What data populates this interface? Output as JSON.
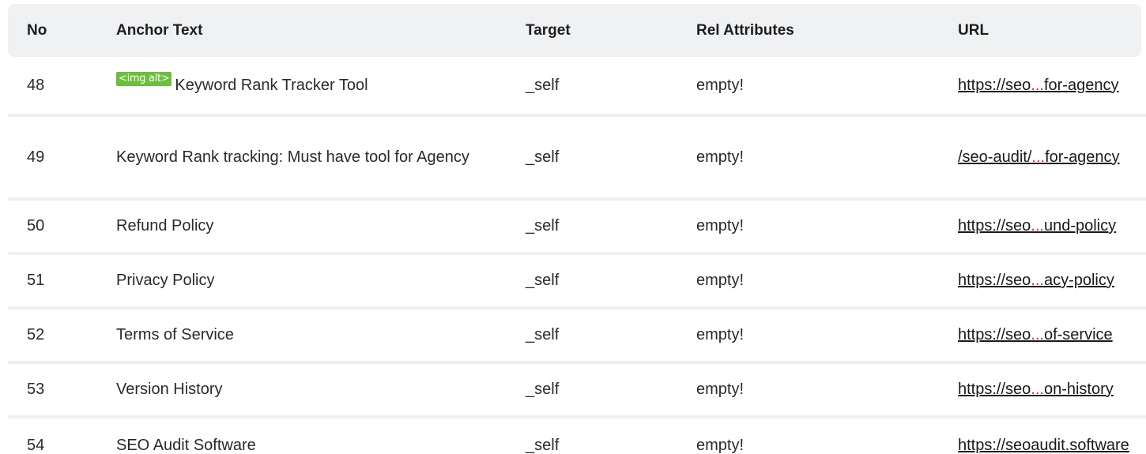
{
  "table": {
    "headers": {
      "no": "No",
      "anchor": "Anchor Text",
      "target": "Target",
      "rel": "Rel Attributes",
      "url": "URL"
    },
    "rows": [
      {
        "no": "48",
        "badge": "<img alt>",
        "anchor": "Keyword Rank Tracker Tool",
        "target": "_self",
        "rel": "empty!",
        "url_start": "https://seo",
        "url_ellipsis": "...",
        "url_end": "for-agency"
      },
      {
        "no": "49",
        "anchor": "Keyword Rank tracking: Must have tool for Agency",
        "target": "_self",
        "rel": "empty!",
        "url_start": "/seo-audit/",
        "url_ellipsis": "...",
        "url_end": "for-agency"
      },
      {
        "no": "50",
        "anchor": "Refund Policy",
        "target": "_self",
        "rel": "empty!",
        "url_start": "https://seo",
        "url_ellipsis": "...",
        "url_end": "und-policy"
      },
      {
        "no": "51",
        "anchor": "Privacy Policy",
        "target": "_self",
        "rel": "empty!",
        "url_start": "https://seo",
        "url_ellipsis": "...",
        "url_end": "acy-policy"
      },
      {
        "no": "52",
        "anchor": "Terms of Service",
        "target": "_self",
        "rel": "empty!",
        "url_start": "https://seo",
        "url_ellipsis": "...",
        "url_end": "of-service"
      },
      {
        "no": "53",
        "anchor": "Version History",
        "target": "_self",
        "rel": "empty!",
        "url_start": "https://seo",
        "url_ellipsis": "...",
        "url_end": "on-history"
      },
      {
        "no": "54",
        "anchor": "SEO Audit Software",
        "target": "_self",
        "rel": "empty!",
        "url_start": "https://seoaudit.software",
        "url_ellipsis": "",
        "url_end": ""
      }
    ]
  },
  "colors": {
    "header_bg": "#f0f1f3",
    "row_divider": "#eef0f2",
    "badge_bg": "#6cbf3c",
    "ellipsis": "#e03030"
  }
}
